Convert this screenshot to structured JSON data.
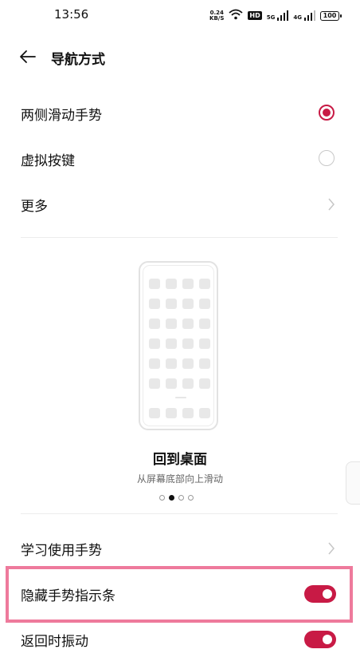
{
  "status_bar": {
    "time": "13:56",
    "net_speed_value": "0.24",
    "net_speed_unit": "KB/S",
    "hd_badge": "HD",
    "signal1_label": "5G",
    "signal2_label": "4G",
    "battery": "100"
  },
  "header": {
    "title": "导航方式"
  },
  "options": [
    {
      "label": "两侧滑动手势",
      "selected": true
    },
    {
      "label": "虚拟按键",
      "selected": false
    }
  ],
  "more": {
    "label": "更多"
  },
  "animation": {
    "title": "回到桌面",
    "subtitle": "从屏幕底部向上滑动",
    "page_count": 4,
    "active_page": 2
  },
  "learn": {
    "label": "学习使用手势"
  },
  "toggles": [
    {
      "label": "隐藏手势指示条",
      "on": true
    },
    {
      "label": "返回时振动",
      "on": true
    }
  ],
  "colors": {
    "accent": "#c81a45",
    "highlight": "#ee7a9c"
  }
}
